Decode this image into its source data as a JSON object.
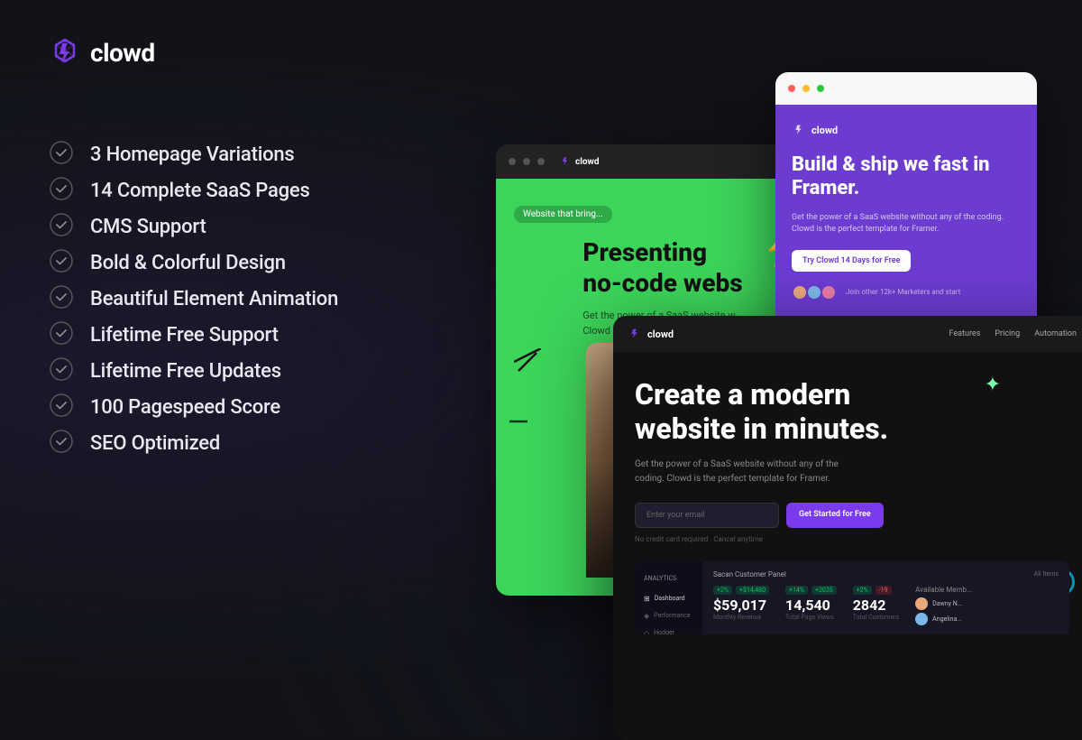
{
  "brand": {
    "name": "clowd",
    "logo_alt": "clowd logo"
  },
  "features": [
    {
      "id": "f1",
      "text": "3 Homepage Variations"
    },
    {
      "id": "f2",
      "text": "14 Complete SaaS Pages"
    },
    {
      "id": "f3",
      "text": "CMS Support"
    },
    {
      "id": "f4",
      "text": "Bold & Colorful Design"
    },
    {
      "id": "f5",
      "text": "Beautiful Element Animation"
    },
    {
      "id": "f6",
      "text": "Lifetime Free Support"
    },
    {
      "id": "f7",
      "text": "Lifetime Free Updates"
    },
    {
      "id": "f8",
      "text": "100 Pagespeed Score"
    },
    {
      "id": "f9",
      "text": "SEO Optimized"
    }
  ],
  "preview_green": {
    "badge": "Website that bring...",
    "title": "Presenting\nno-code webs",
    "subtitle": "Get the power of a SaaS website w...\nClowd is the perfect temp..."
  },
  "preview_purple": {
    "title": "Build & ship we\nfast in Framer.",
    "desc": "Get the power of a SaaS website without any of the coding.\nClowd is the perfect template for Framer.",
    "cta": "Try Clowd 14 Days for Free",
    "join_text": "Join other 12k+ Marketers and start"
  },
  "preview_dark": {
    "nav": [
      "Features",
      "Pricing",
      "Automation"
    ],
    "title": "Create a modern\nwebsite in minutes.",
    "desc": "Get the power of a SaaS website without any of the coding. Clowd is the perfect template for Framer.",
    "email_placeholder": "Enter your email",
    "cta": "Get Started for Free",
    "no_card": "No credit card required · Cancel anytime",
    "dashboard": {
      "title": "Sacan Customer Panel",
      "all_items": "All Items",
      "stats": [
        {
          "value": "$59,017",
          "label": "Monthly Revenue",
          "change": "+2%",
          "change2": "+$14,480",
          "positive": true
        },
        {
          "value": "14,540",
          "label": "Total Page Views",
          "change": "+14%",
          "change2": "+2035",
          "positive": true
        },
        {
          "value": "2842",
          "label": "Total Customers",
          "change": "+2%",
          "change2": "-19",
          "positive": false
        }
      ],
      "sidebar_items": [
        "Dashboard",
        "Analytics",
        "Performance",
        "Hodger"
      ]
    }
  },
  "colors": {
    "accent_purple": "#7c3aed",
    "accent_green": "#3dd45a",
    "background": "#111318"
  }
}
